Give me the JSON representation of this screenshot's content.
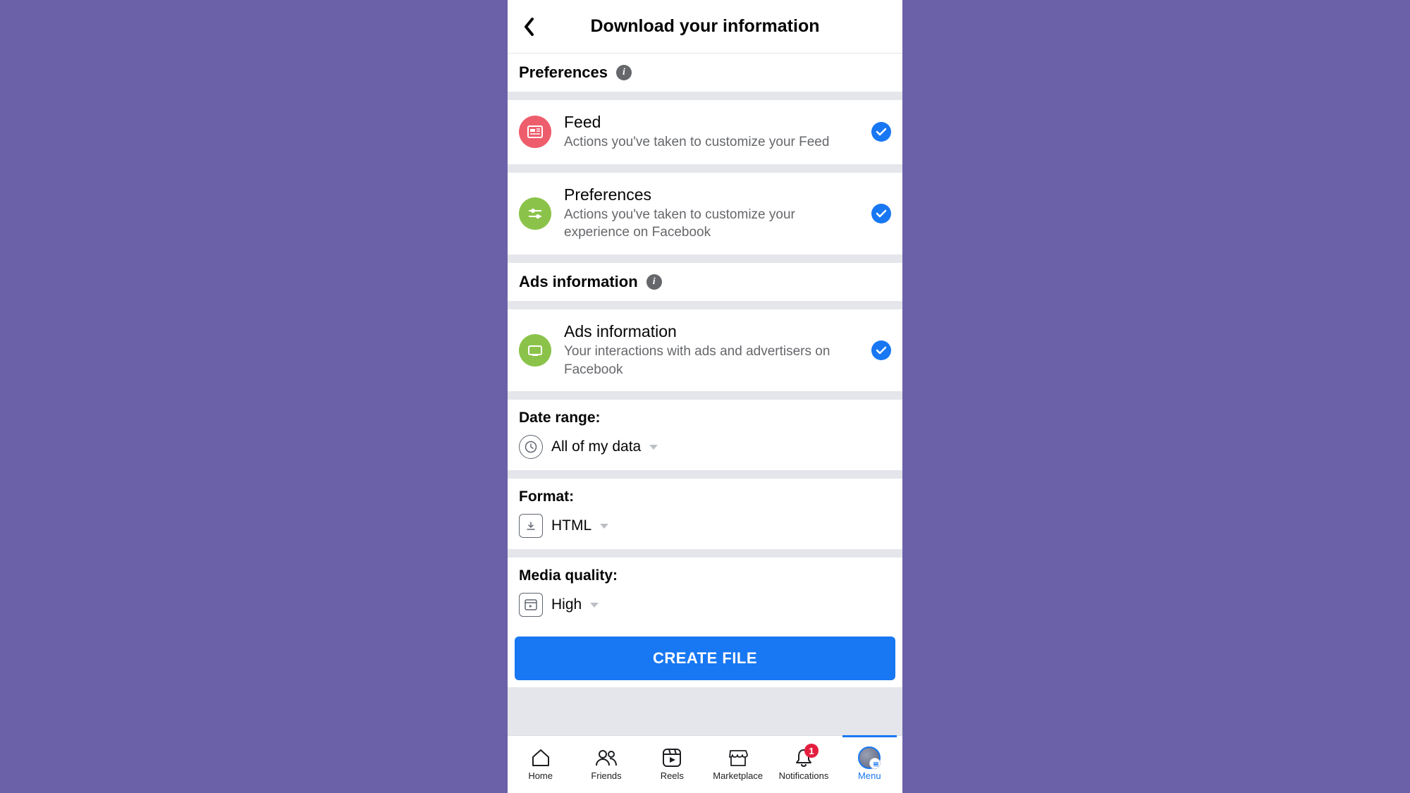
{
  "header": {
    "title": "Download your information"
  },
  "sections": {
    "preferences": {
      "title": "Preferences"
    },
    "ads": {
      "title": "Ads information"
    }
  },
  "items": {
    "feed": {
      "title": "Feed",
      "sub": "Actions you've taken to customize your Feed"
    },
    "prefs": {
      "title": "Preferences",
      "sub": "Actions you've taken to customize your experience on Facebook"
    },
    "ads": {
      "title": "Ads information",
      "sub": "Your interactions with ads and advertisers on Facebook"
    }
  },
  "options": {
    "date_range": {
      "label": "Date range:",
      "value": "All of my data"
    },
    "format": {
      "label": "Format:",
      "value": "HTML"
    },
    "media_quality": {
      "label": "Media quality:",
      "value": "High"
    }
  },
  "cta": {
    "label": "CREATE FILE"
  },
  "tabs": {
    "home": "Home",
    "friends": "Friends",
    "reels": "Reels",
    "marketplace": "Marketplace",
    "notifications": "Notifications",
    "notifications_badge": "1",
    "menu": "Menu"
  },
  "colors": {
    "feed_icon": "#ee5d6c",
    "prefs_icon": "#8bc34a",
    "ads_icon": "#8bc34a",
    "accent": "#1877f2"
  }
}
